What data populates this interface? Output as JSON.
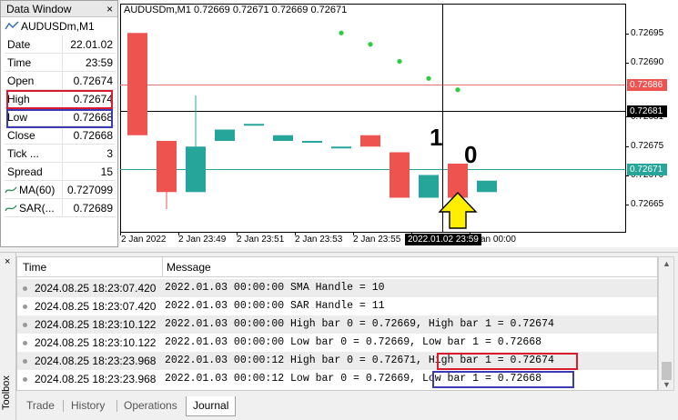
{
  "data_window": {
    "title": "Data Window",
    "close": "×",
    "symbol": "AUDUSDm,M1",
    "rows": [
      {
        "key": "Date",
        "value": "22.01.02"
      },
      {
        "key": "Time",
        "value": "23:59"
      },
      {
        "key": "Open",
        "value": "0.72674"
      },
      {
        "key": "High",
        "value": "0.72674"
      },
      {
        "key": "Low",
        "value": "0.72668"
      },
      {
        "key": "Close",
        "value": "0.72668"
      },
      {
        "key": "Tick ...",
        "value": "3"
      },
      {
        "key": "Spread",
        "value": "15"
      },
      {
        "key": "MA(60)",
        "value": "0.727099"
      },
      {
        "key": "SAR(...",
        "value": "0.72689"
      }
    ]
  },
  "chart": {
    "header": "AUDUSDm,M1  0.72669 0.72671 0.72669 0.72671",
    "y_ticks": [
      "0.72695",
      "0.72690",
      "0.72681",
      "0.72675",
      "0.72670",
      "0.72665"
    ],
    "price_labels": {
      "red": "0.72686",
      "crosshair": "0.72681",
      "teal": "0.72671"
    },
    "x_ticks": [
      "2 Jan 2022",
      "2 Jan 23:49",
      "2 Jan 23:51",
      "2 Jan 23:53",
      "2 Jan 23:55",
      "Jan 00:00"
    ],
    "crosshair_time": "2022.01.02 23:59",
    "bar_numbers": [
      "1",
      "0"
    ],
    "colors": {
      "bull": "#26a69a",
      "bear": "#ef5350",
      "sar": "#2ecc40",
      "arrow": "#ffee00"
    }
  },
  "chart_data": {
    "type": "candlestick",
    "series": [
      {
        "name": "AUDUSDm,M1"
      }
    ],
    "candles": [
      {
        "o": 0.72697,
        "h": 0.72697,
        "l": 0.72679,
        "c": 0.72679
      },
      {
        "o": 0.72678,
        "h": 0.72678,
        "l": 0.72666,
        "c": 0.72669
      },
      {
        "o": 0.72669,
        "h": 0.72686,
        "l": 0.72669,
        "c": 0.72677
      },
      {
        "o": 0.72678,
        "h": 0.7268,
        "l": 0.72678,
        "c": 0.7268
      },
      {
        "o": 0.72681,
        "h": 0.72681,
        "l": 0.72681,
        "c": 0.72681
      },
      {
        "o": 0.72678,
        "h": 0.72679,
        "l": 0.72678,
        "c": 0.72679
      },
      {
        "o": 0.72678,
        "h": 0.72678,
        "l": 0.72678,
        "c": 0.72678
      },
      {
        "o": 0.72677,
        "h": 0.72677,
        "l": 0.72677,
        "c": 0.72677
      },
      {
        "o": 0.72679,
        "h": 0.72679,
        "l": 0.72677,
        "c": 0.72677
      },
      {
        "o": 0.72676,
        "h": 0.72676,
        "l": 0.72668,
        "c": 0.72668
      },
      {
        "o": 0.72668,
        "h": 0.72672,
        "l": 0.72668,
        "c": 0.72672
      },
      {
        "o": 0.72674,
        "h": 0.72674,
        "l": 0.72668,
        "c": 0.72668
      },
      {
        "o": 0.72669,
        "h": 0.72671,
        "l": 0.72669,
        "c": 0.72671
      }
    ],
    "sar": [
      null,
      null,
      null,
      null,
      null,
      null,
      null,
      0.72697,
      0.72695,
      0.72692,
      0.72689,
      0.72687,
      null
    ],
    "ylim": [
      0.72662,
      0.72702
    ]
  },
  "journal": {
    "col_time": "Time",
    "col_message": "Message",
    "rows": [
      {
        "time": "2024.08.25 18:23:07.420",
        "msg": "2022.01.03 00:00:00   SMA Handle = 10"
      },
      {
        "time": "2024.08.25 18:23:07.420",
        "msg": "2022.01.03 00:00:00   SAR Handle = 11"
      },
      {
        "time": "2024.08.25 18:23:10.122",
        "msg": "2022.01.03 00:00:00   High bar 0 = 0.72669, High bar 1 = 0.72674"
      },
      {
        "time": "2024.08.25 18:23:10.122",
        "msg": "2022.01.03 00:00:00   Low bar 0 = 0.72669, Low bar 1 = 0.72668"
      },
      {
        "time": "2024.08.25 18:23:23.968",
        "msg": "2022.01.03 00:00:12   High bar 0 = 0.72671, High bar 1 = 0.72674"
      },
      {
        "time": "2024.08.25 18:23:23.968",
        "msg": "2022.01.03 00:00:12   Low bar 0 = 0.72669, Low bar 1 = 0.72668"
      }
    ]
  },
  "toolbox": {
    "label": "Toolbox",
    "close": "×",
    "tabs": [
      "Trade",
      "History",
      "Operations",
      "Journal"
    ],
    "active_tab": "Journal"
  }
}
